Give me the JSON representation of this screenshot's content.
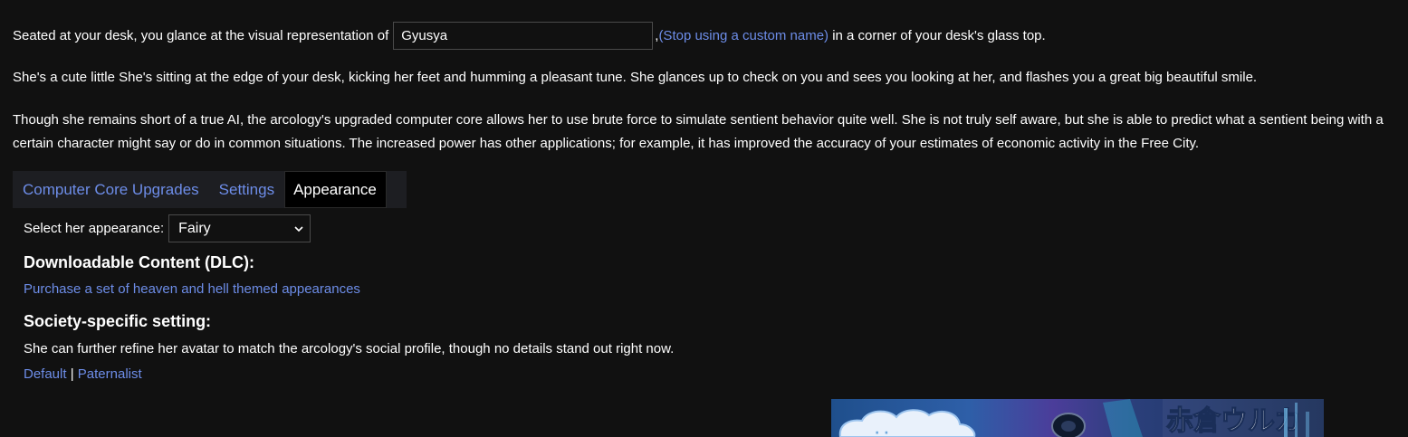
{
  "intro": {
    "before": "Seated at your desk, you glance at the visual representation of",
    "name_value": "Gyusya",
    "comma": ",",
    "stop_link": "(Stop using a custom name)",
    "after": "in a corner of your desk's glass top."
  },
  "paragraph2": "She's a cute little She's sitting at the edge of your desk, kicking her feet and humming a pleasant tune. She glances up to check on you and sees you looking at her, and flashes you a great big beautiful smile.",
  "paragraph3": "Though she remains short of a true AI, the arcology's upgraded computer core allows her to use brute force to simulate sentient behavior quite well. She is not truly self aware, but she is able to predict what a sentient being with a certain character might say or do in common situations. The increased power has other applications; for example, it has improved the accuracy of your estimates of economic activity in the Free City.",
  "tabs": [
    {
      "label": "Computer Core Upgrades"
    },
    {
      "label": "Settings"
    },
    {
      "label": "Appearance"
    }
  ],
  "appearance": {
    "select_label": "Select her appearance:",
    "selected_value": "Fairy"
  },
  "dlc": {
    "heading": "Downloadable Content (DLC):",
    "link": "Purchase a set of heaven and hell themed appearances"
  },
  "society": {
    "heading": "Society-specific setting:",
    "text": "She can further refine her avatar to match the arcology's social profile, though no details stand out right now.",
    "options": [
      "Default",
      "Paternalist"
    ],
    "separator": "|"
  },
  "avatar_image": {
    "caption": "赤倉ウルカ"
  },
  "colors": {
    "background": "#111111",
    "link": "#6d8de8",
    "tab_bar": "#1d1e22",
    "active_tab": "#000000"
  }
}
